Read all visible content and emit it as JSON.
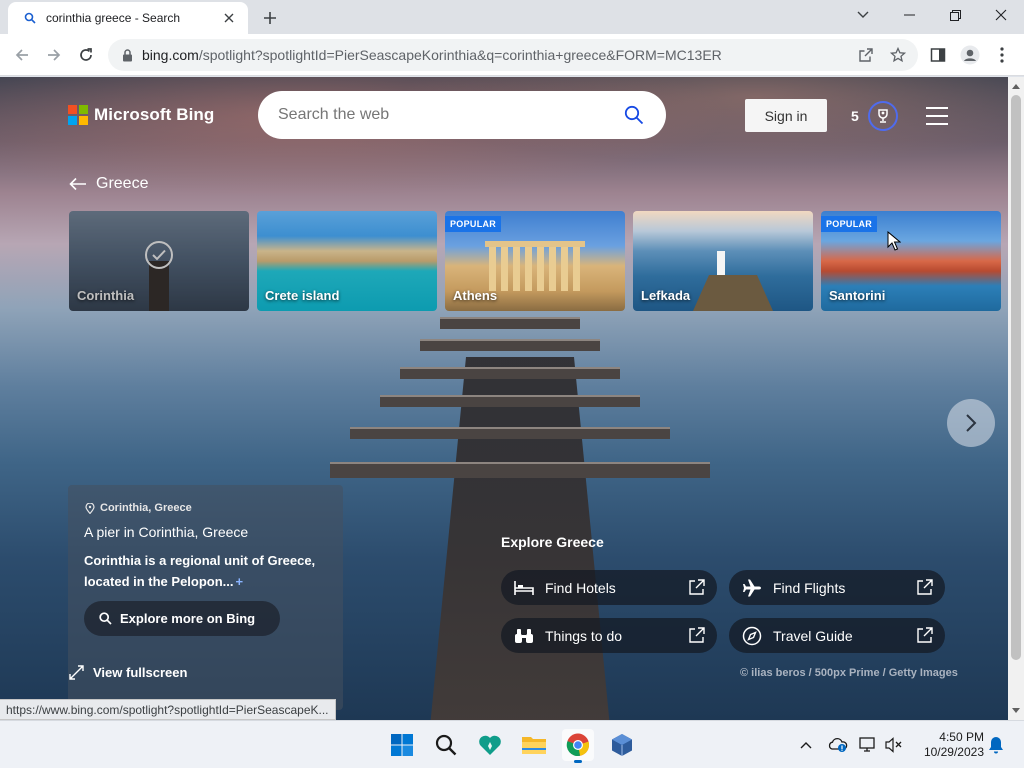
{
  "browser": {
    "tab_title": "corinthia greece - Search",
    "url_host": "bing.com",
    "url_path": "/spotlight?spotlightId=PierSeascapeKorinthia&q=corinthia+greece&FORM=MC13ER",
    "status_url": "https://www.bing.com/spotlight?spotlightId=PierSeascapeK..."
  },
  "header": {
    "brand": "Microsoft Bing",
    "search_placeholder": "Search the web",
    "signin_label": "Sign in",
    "rewards_count": "5"
  },
  "breadcrumb": {
    "back_label": "Greece"
  },
  "carousel": {
    "cards": [
      {
        "label": "Corinthia",
        "badge": "",
        "selected": true
      },
      {
        "label": "Crete island",
        "badge": ""
      },
      {
        "label": "Athens",
        "badge": "POPULAR"
      },
      {
        "label": "Lefkada",
        "badge": ""
      },
      {
        "label": "Santorini",
        "badge": "POPULAR"
      }
    ]
  },
  "info": {
    "location": "Corinthia, Greece",
    "title": "A pier in Corinthia, Greece",
    "description": "Corinthia is a regional unit of Greece, located in the Pelopon...",
    "more_symbol": "+",
    "explore_label": "Explore more on Bing",
    "fullscreen_label": "View fullscreen"
  },
  "explore": {
    "heading": "Explore Greece",
    "items": [
      {
        "label": "Find Hotels",
        "icon": "bed-icon"
      },
      {
        "label": "Find Flights",
        "icon": "plane-icon"
      },
      {
        "label": "Things to do",
        "icon": "binoculars-icon"
      },
      {
        "label": "Travel Guide",
        "icon": "compass-icon"
      }
    ]
  },
  "credit": "© ilias beros / 500px Prime / Getty Images",
  "taskbar": {
    "time": "4:50 PM",
    "date": "10/29/2023"
  },
  "colors": {
    "accent": "#1a73e8",
    "windows_blue": "#0067c0"
  }
}
